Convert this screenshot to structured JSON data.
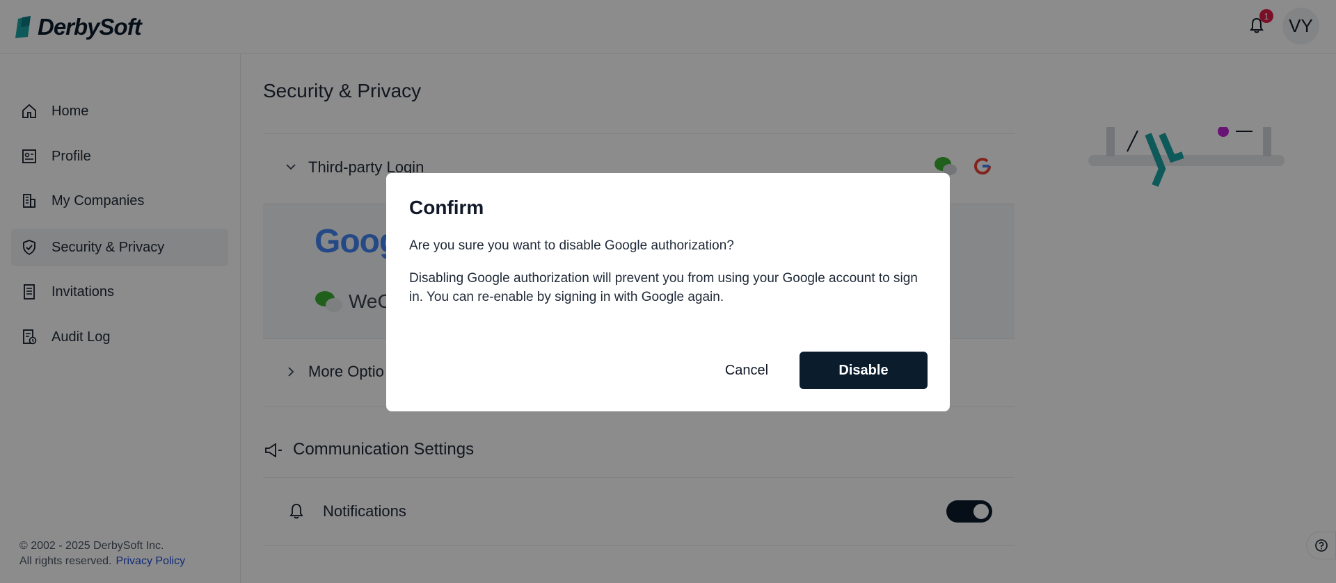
{
  "app": {
    "brand": "DerbySoft",
    "notification_count": "1",
    "user_initials": "VY"
  },
  "sidebar": {
    "items": [
      {
        "label": "Home",
        "icon": "home-icon"
      },
      {
        "label": "Profile",
        "icon": "profile-icon"
      },
      {
        "label": "My Companies",
        "icon": "building-icon"
      },
      {
        "label": "Security & Privacy",
        "icon": "shield-icon",
        "active": true
      },
      {
        "label": "Invitations",
        "icon": "document-icon"
      },
      {
        "label": "Audit Log",
        "icon": "audit-icon"
      }
    ],
    "footer": {
      "copyright": "© 2002 - 2025 DerbySoft Inc.",
      "rights": "All rights reserved.",
      "privacy_link": "Privacy Policy"
    }
  },
  "main": {
    "title": "Security & Privacy",
    "third_party": {
      "label": "Third-party Login",
      "google_word": "Goog",
      "wechat_word": "WeC"
    },
    "more_options": {
      "label": "More Optio"
    },
    "communication": {
      "title": "Communication Settings",
      "notifications_label": "Notifications",
      "notifications_enabled": true
    }
  },
  "modal": {
    "title": "Confirm",
    "question": "Are you sure you want to disable Google authorization?",
    "description": "Disabling Google authorization will prevent you from using your Google account to sign in. You can re-enable by signing in with Google again.",
    "cancel_label": "Cancel",
    "disable_label": "Disable"
  },
  "colors": {
    "primary": "#0b1c2c",
    "badge": "#e11d48",
    "link": "#1d4ed8",
    "wechat": "#3cb034"
  }
}
